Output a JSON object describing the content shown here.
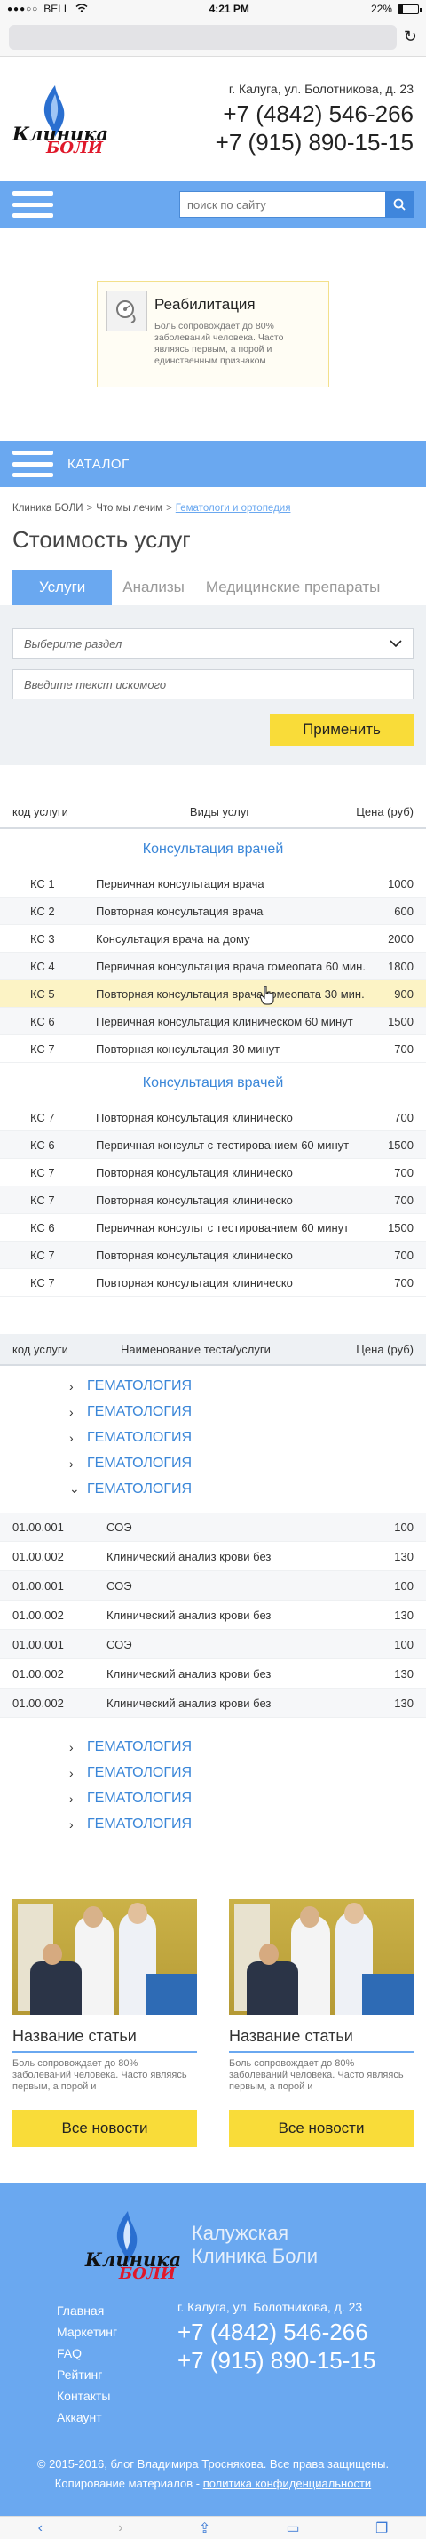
{
  "status_bar": {
    "carrier": "BELL",
    "time": "4:21 PM",
    "battery_text": "22%",
    "battery_level": 0.22
  },
  "header": {
    "logo_line1": "Клиника",
    "logo_line2": "БОЛИ",
    "address": "г. Калуга, ул. Болотникова, д. 23",
    "phone1": "+7 (4842) 546-266",
    "phone2": "+7 (915) 890-15-15"
  },
  "search": {
    "placeholder": "поиск по сайту"
  },
  "promo": {
    "title": "Реабилитация",
    "text": "Боль сопровождает до 80% заболеваний человека. Часто являясь первым, а порой и единственным признаком"
  },
  "catalog": {
    "label": "КАТАЛОГ"
  },
  "breadcrumb": [
    "Клиника БОЛИ",
    "Что мы лечим",
    "Гематологи и ортопедия"
  ],
  "page_title": "Стоимость услуг",
  "tabs": [
    {
      "label": "Услуги",
      "active": true
    },
    {
      "label": "Анализы",
      "active": false
    },
    {
      "label": "Медицинские препараты",
      "active": false
    }
  ],
  "filter": {
    "select_placeholder": "Выберите раздел",
    "text_placeholder": "Введите текст искомого",
    "apply_label": "Применить"
  },
  "price_table": {
    "headers": [
      "код услуги",
      "Виды услуг",
      "Цена (руб)"
    ],
    "sections": [
      {
        "title": "Консультация врачей",
        "rows": [
          {
            "code": "КС 1",
            "name": "Первичная консультация врача",
            "price": "1000"
          },
          {
            "code": "КС 2",
            "name": "Повторная консультация врача",
            "price": "600"
          },
          {
            "code": "КС 3",
            "name": "Консультация врача на дому",
            "price": "2000"
          },
          {
            "code": "КС 4",
            "name": "Первичная консультация врача гомеопата 60 мин.",
            "price": "1800"
          },
          {
            "code": "КС 5",
            "name": "Повторная консультация врача гомеопата 30 мин.",
            "price": "900"
          },
          {
            "code": "КС 6",
            "name": "Первичная консультация клиническом 60 минут",
            "price": "1500"
          },
          {
            "code": "КС 7",
            "name": "Повторная консультация   30 минут",
            "price": "700"
          }
        ]
      },
      {
        "title": "Консультация врачей",
        "rows": [
          {
            "code": "КС 7",
            "name": "Повторная консультация клиническо",
            "price": "700"
          },
          {
            "code": "КС 6",
            "name": "Первичная консульт  с тестированием 60 минут",
            "price": "1500"
          },
          {
            "code": "КС 7",
            "name": "Повторная консультация клиническо",
            "price": "700"
          },
          {
            "code": "КС 7",
            "name": "Повторная консультация клиническо",
            "price": "700"
          },
          {
            "code": "КС 6",
            "name": "Первичная консульт  с тестированием 60 минут",
            "price": "1500"
          },
          {
            "code": "КС 7",
            "name": "Повторная консультация клиническо",
            "price": "700"
          },
          {
            "code": "КС 7",
            "name": "Повторная консультация клиническо",
            "price": "700"
          }
        ]
      }
    ]
  },
  "tests_table": {
    "headers": [
      "код услуги",
      "Наименование теста/услуги",
      "Цена (руб)"
    ],
    "groups_top": [
      {
        "label": "ГЕМАТОЛОГИЯ",
        "chevron": "›"
      },
      {
        "label": "ГЕМАТОЛОГИЯ",
        "chevron": "›"
      },
      {
        "label": "ГЕМАТОЛОГИЯ",
        "chevron": "›"
      },
      {
        "label": "ГЕМАТОЛОГИЯ",
        "chevron": "›"
      },
      {
        "label": "ГЕМАТОЛОГИЯ",
        "chevron": "⌄"
      }
    ],
    "rows": [
      {
        "code": "01.00.001",
        "name": "СОЭ",
        "price": "100"
      },
      {
        "code": "01.00.002",
        "name": "Клинический анализ крови без",
        "price": "130"
      },
      {
        "code": "01.00.001",
        "name": "СОЭ",
        "price": "100"
      },
      {
        "code": "01.00.002",
        "name": "Клинический анализ крови без",
        "price": "130"
      },
      {
        "code": "01.00.001",
        "name": "СОЭ",
        "price": "100"
      },
      {
        "code": "01.00.002",
        "name": "Клинический анализ крови без",
        "price": "130"
      },
      {
        "code": "01.00.002",
        "name": "Клинический анализ крови без",
        "price": "130"
      }
    ],
    "groups_bottom": [
      {
        "label": "ГЕМАТОЛОГИЯ",
        "chevron": "›"
      },
      {
        "label": "ГЕМАТОЛОГИЯ",
        "chevron": "›"
      },
      {
        "label": "ГЕМАТОЛОГИЯ",
        "chevron": "›"
      },
      {
        "label": "ГЕМАТОЛОГИЯ",
        "chevron": "›"
      }
    ]
  },
  "articles": [
    {
      "title": "Название статьи",
      "text": "Боль сопровождает до 80% заболеваний человека. Часто являясь первым, а порой и",
      "button": "Все новости"
    },
    {
      "title": "Название статьи",
      "text": "Боль сопровождает до 80% заболеваний человека. Часто являясь первым, а порой и",
      "button": "Все новости"
    }
  ],
  "footer": {
    "logo_line1": "Клиника",
    "logo_line2": "БОЛИ",
    "name_line1": "Калужская",
    "name_line2": "Клиника Боли",
    "menu": [
      "Главная",
      "Маркетинг",
      "FAQ",
      "Рейтинг",
      "Контакты",
      "Аккаунт"
    ],
    "address": "г. Калуга, ул. Болотникова, д. 23",
    "phone1": "+7 (4842) 546-266",
    "phone2": "+7 (915) 890-15-15",
    "copyright": "© 2015-2016, блог Владимира Троснякова. Все права защищены.",
    "copy_prefix": "Копирование материалов - ",
    "copy_link": "политика конфиденциальности"
  },
  "colors": {
    "accent_blue": "#6aa8f0",
    "link_blue": "#3a86d8",
    "button_yellow": "#f9dc39",
    "highlight_row": "#fcf3c5"
  }
}
